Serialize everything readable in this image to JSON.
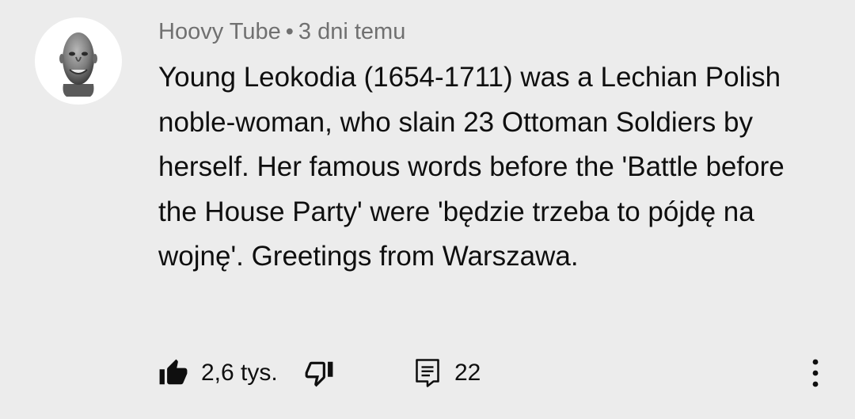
{
  "comment": {
    "author": "Hoovy Tube",
    "separator": "•",
    "timestamp": "3 dni temu",
    "text": "Young Leokodia (1654-1711) was a Lechian Polish noble-woman, who slain 23 Ottoman Soldiers by herself. Her famous words before the 'Battle before the House Party' were 'będzie trzeba to pójdę na wojnę'. Greetings from Warszawa.",
    "like_count": "2,6 tys.",
    "reply_count": "22"
  },
  "icons": {
    "avatar": "bald-man-avatar",
    "like": "thumb-up-filled-icon",
    "dislike": "thumb-down-outline-icon",
    "reply": "comment-reply-icon",
    "more": "more-vertical-icon"
  },
  "colors": {
    "background": "#ececec",
    "text": "#0f0f0f",
    "meta_text": "#707070",
    "avatar_bg": "#ffffff"
  }
}
